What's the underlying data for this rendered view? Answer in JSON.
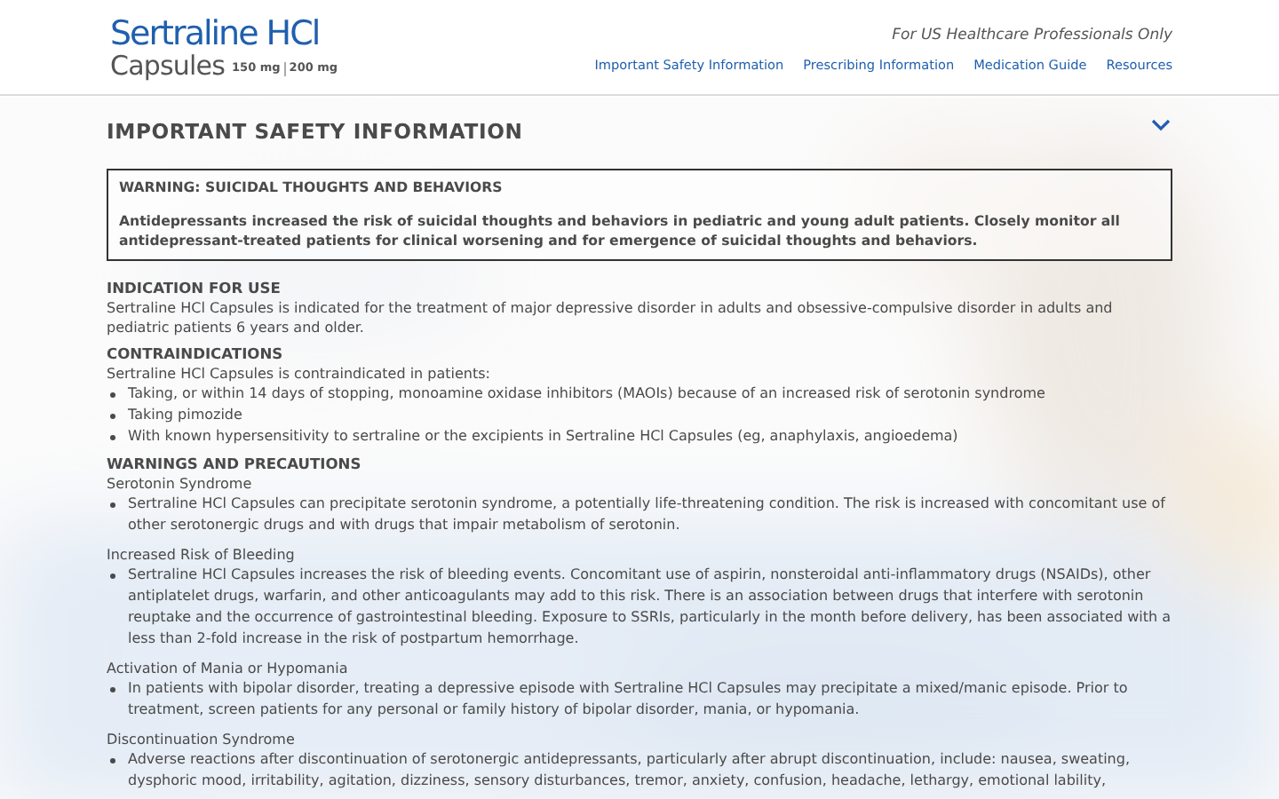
{
  "header": {
    "logo": {
      "name": "Sertraline HCl",
      "form": "Capsules",
      "strengths": [
        "150 mg",
        "200 mg"
      ]
    },
    "tagline": "For US Healthcare Professionals Only",
    "nav": [
      "Important Safety Information",
      "Prescribing Information",
      "Medication Guide",
      "Resources"
    ]
  },
  "isi": {
    "title": "IMPORTANT SAFETY INFORMATION",
    "boxed_warning": {
      "title": "WARNING: SUICIDAL THOUGHTS AND BEHAVIORS",
      "text": "Antidepressants increased the risk of suicidal thoughts and behaviors in pediatric and young adult patients. Closely monitor all antidepressant-treated patients for clinical worsening and for emergence of suicidal thoughts and behaviors."
    },
    "sections": [
      {
        "heading": "INDICATION FOR USE",
        "body": "Sertraline HCl Capsules is indicated for the treatment of major depressive disorder in adults and obsessive-compulsive disorder in adults and pediatric patients 6 years and older."
      },
      {
        "heading": "CONTRAINDICATIONS",
        "body": "Sertraline HCl Capsules is contraindicated in patients:",
        "bullets": [
          "Taking, or within 14 days of stopping, monoamine oxidase inhibitors (MAOIs) because of an increased risk of serotonin syndrome",
          "Taking pimozide",
          "With known hypersensitivity to sertraline or the excipients in Sertraline HCl Capsules (eg, anaphylaxis, angioedema)"
        ]
      },
      {
        "heading": "WARNINGS AND PRECAUTIONS",
        "subsections": [
          {
            "heading": "Serotonin Syndrome",
            "bullets": [
              "Sertraline HCl Capsules can precipitate serotonin syndrome, a potentially life-threatening condition. The risk is increased with concomitant use of other serotonergic drugs and with drugs that impair metabolism of serotonin."
            ]
          },
          {
            "heading": "Increased Risk of Bleeding",
            "bullets": [
              "Sertraline HCl Capsules increases the risk of bleeding events. Concomitant use of aspirin, nonsteroidal anti-inflammatory drugs (NSAIDs), other antiplatelet drugs, warfarin, and other anticoagulants may add to this risk. There is an association between drugs that interfere with serotonin reuptake and the occurrence of gastrointestinal bleeding. Exposure to SSRIs, particularly in the month before delivery, has been associated with a less than 2-fold increase in the risk of postpartum hemorrhage."
            ]
          },
          {
            "heading": "Activation of Mania or Hypomania",
            "bullets": [
              "In patients with bipolar disorder, treating a depressive episode with Sertraline HCl Capsules may precipitate a mixed/manic episode. Prior to treatment, screen patients for any personal or family history of bipolar disorder, mania, or hypomania."
            ]
          },
          {
            "heading": "Discontinuation Syndrome",
            "bullets": [
              "Adverse reactions after discontinuation of serotonergic antidepressants, particularly after abrupt discontinuation, include: nausea, sweating, dysphoric mood, irritability, agitation, dizziness, sensory disturbances, tremor, anxiety, confusion, headache, lethargy, emotional lability,"
            ]
          }
        ]
      }
    ]
  }
}
